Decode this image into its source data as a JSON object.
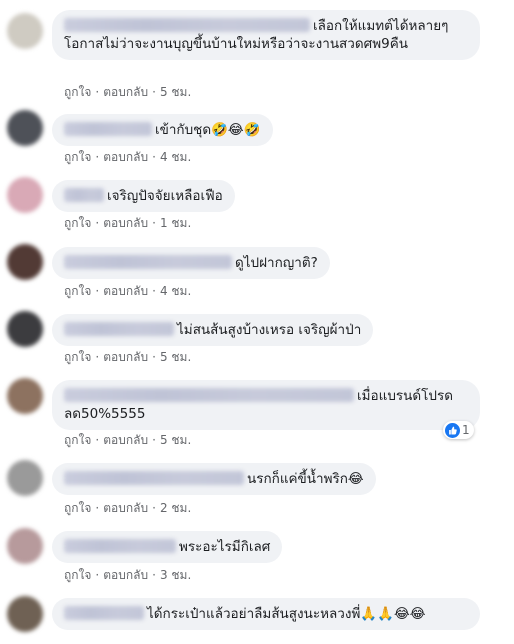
{
  "actions": {
    "like": "ถูกใจ",
    "reply": "ตอบกลับ",
    "dot": "·"
  },
  "comments": [
    {
      "text": "เลือกให้แมทต์ได้หลายๆโอกาสไม่ว่าจะงานบุญขึ้นบ้านใหม่หรือว่าจะงานสวดศพ9คืน",
      "time": "5 ชม."
    },
    {
      "text": "เข้ากับชุด🤣😂🤣",
      "time": "4 ชม."
    },
    {
      "text": "เจริญปัจจัยเหลือเฟือ",
      "time": "1 ชม."
    },
    {
      "text": "ดูไปฝากญาติ?",
      "time": "4 ชม."
    },
    {
      "text": "ไม่สนส้นสูงบ้างเหรอ เจริญผ้าป่า",
      "time": "5 ชม."
    },
    {
      "text": "เมื่อแบรนด์โปรดลด50%5555",
      "time": "5 ชม.",
      "reaction_count": "1"
    },
    {
      "text": "นรกก็แค่ขี้น้ำพริก😂",
      "time": "2 ชม."
    },
    {
      "text": "พระอะไรมีกิเลศ",
      "time": "3 ชม."
    },
    {
      "text": "ได้กระเป๋าแล้วอย่าลืมส้นสูงนะหลวงพี่🙏🙏😂😂",
      "time": ""
    }
  ],
  "colors": {
    "bubble": "#f0f2f5",
    "meta": "#65676b",
    "like": "#1877f2"
  }
}
